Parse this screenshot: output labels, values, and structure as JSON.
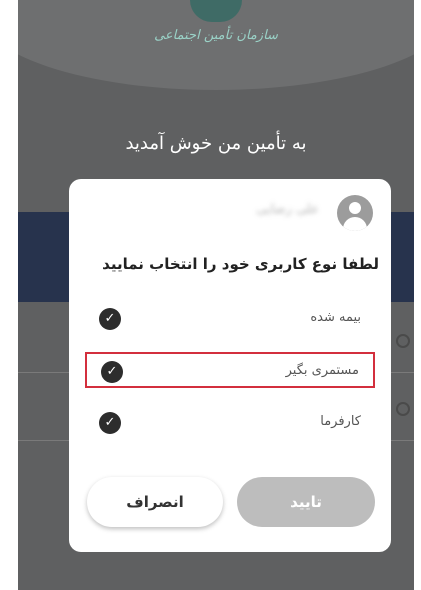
{
  "header": {
    "org_name": "سازمان تأمین اجتماعی"
  },
  "welcome_text": "به تأمین من خوش آمدید",
  "dialog": {
    "username": "علی رضایی",
    "prompt": "لطفا نوع کاربری خود را انتخاب نمایید",
    "options": [
      {
        "label": "بیمه شده",
        "icon": "check-circle-icon"
      },
      {
        "label": "مستمری بگیر",
        "icon": "check-circle-icon",
        "highlighted": true
      },
      {
        "label": "کارفرما",
        "icon": "check-circle-icon"
      }
    ],
    "confirm_label": "تایید",
    "cancel_label": "انصراف"
  },
  "colors": {
    "backdrop": "#5f6061",
    "band": "#27334d",
    "highlight_border": "#d32f3d",
    "check": "#2d2d2d",
    "confirm_bg": "#bdbdbd"
  }
}
